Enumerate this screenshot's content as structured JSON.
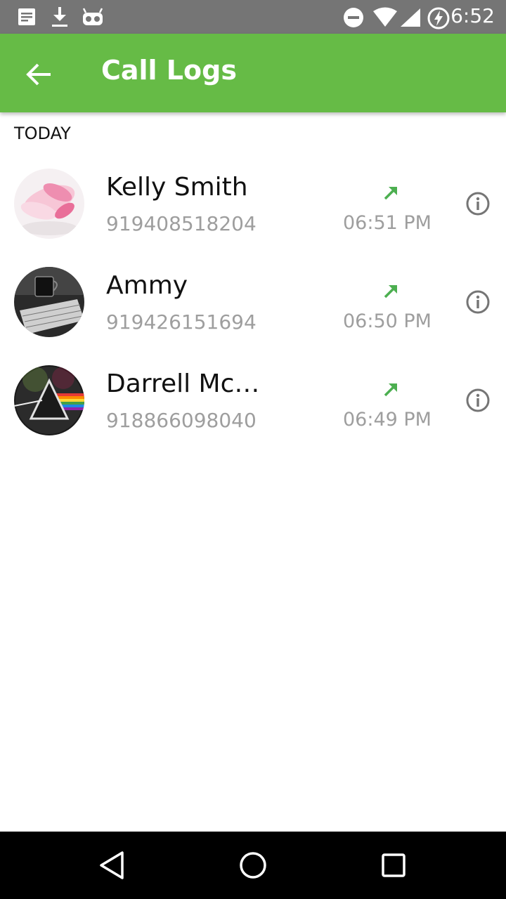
{
  "status_bar": {
    "time": "6:52",
    "icons": [
      "notes-icon",
      "download-icon",
      "android-robot-icon",
      "do-not-disturb-icon",
      "wifi-icon",
      "cell-signal-icon",
      "battery-charging-icon"
    ]
  },
  "app_bar": {
    "title": "Call Logs",
    "back_icon": "arrow-back-icon",
    "color": "#66bb46"
  },
  "section": {
    "header": "TODAY"
  },
  "calls": [
    {
      "name": "Kelly Smith",
      "number": "919408518204",
      "time": "06:51 PM",
      "type": "outgoing",
      "avatar": "pink-flower-petals"
    },
    {
      "name": "Ammy",
      "number": "919426151694",
      "time": "06:50 PM",
      "type": "outgoing",
      "avatar": "keyboard-and-mug"
    },
    {
      "name": "Darrell Mc…",
      "number": "918866098040",
      "time": "06:49 PM",
      "type": "outgoing",
      "avatar": "prism-rainbow"
    }
  ],
  "colors": {
    "outgoing_arrow": "#4caf50",
    "secondary_text": "#9e9e9e",
    "status_bar": "#757575"
  },
  "nav_bar": {
    "icons": [
      "back-triangle-icon",
      "home-circle-icon",
      "recents-square-icon"
    ]
  }
}
